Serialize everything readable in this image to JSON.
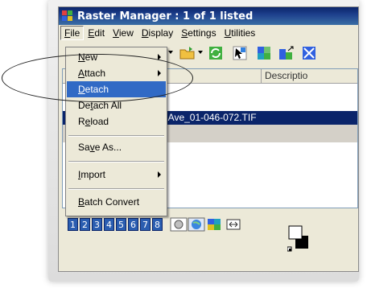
{
  "window": {
    "title": "Raster Manager : 1 of 1 listed"
  },
  "menubar": {
    "items": [
      {
        "mnemonic": "F",
        "rest": "ile"
      },
      {
        "mnemonic": "E",
        "rest": "dit"
      },
      {
        "mnemonic": "V",
        "rest": "iew"
      },
      {
        "mnemonic": "D",
        "rest": "isplay"
      },
      {
        "mnemonic": "S",
        "rest": "ettings"
      },
      {
        "mnemonic": "U",
        "rest": "tilities"
      }
    ]
  },
  "list": {
    "column_description": "Descriptio",
    "selected_row_text": "x Ave_01-046-072.TIF"
  },
  "file_menu": {
    "items": [
      {
        "pre": "",
        "mnemonic": "N",
        "post": "ew",
        "submenu": true
      },
      {
        "pre": "",
        "mnemonic": "A",
        "post": "ttach",
        "submenu": true
      },
      {
        "pre": "",
        "mnemonic": "D",
        "post": "etach",
        "submenu": false,
        "selected": true
      },
      {
        "pre": "De",
        "mnemonic": "t",
        "post": "ach All",
        "submenu": false
      },
      {
        "pre": "R",
        "mnemonic": "e",
        "post": "load",
        "submenu": false
      },
      {
        "pre": "Sa",
        "mnemonic": "v",
        "post": "e As...",
        "submenu": false
      },
      {
        "pre": "",
        "mnemonic": "I",
        "post": "mport",
        "submenu": true
      },
      {
        "pre": "",
        "mnemonic": "B",
        "post": "atch Convert",
        "submenu": false
      }
    ]
  },
  "view_buttons": [
    "1",
    "2",
    "3",
    "4",
    "5",
    "6",
    "7",
    "8"
  ],
  "icons": {
    "app": "raster-manager-icon",
    "toolbar": [
      "new-icon",
      "open-folder-icon",
      "refresh-icon",
      "select-tool-icon",
      "raster-layer-icon",
      "raster-arrow-icon"
    ],
    "bottom": [
      "view-group-icon",
      "globe-icon",
      "raster-display-icon",
      "fit-icon",
      "color-swatch-icon"
    ]
  },
  "colors": {
    "title_bar": "#0a246a",
    "highlight": "#316ac5",
    "view_button": "#2a5db0"
  }
}
